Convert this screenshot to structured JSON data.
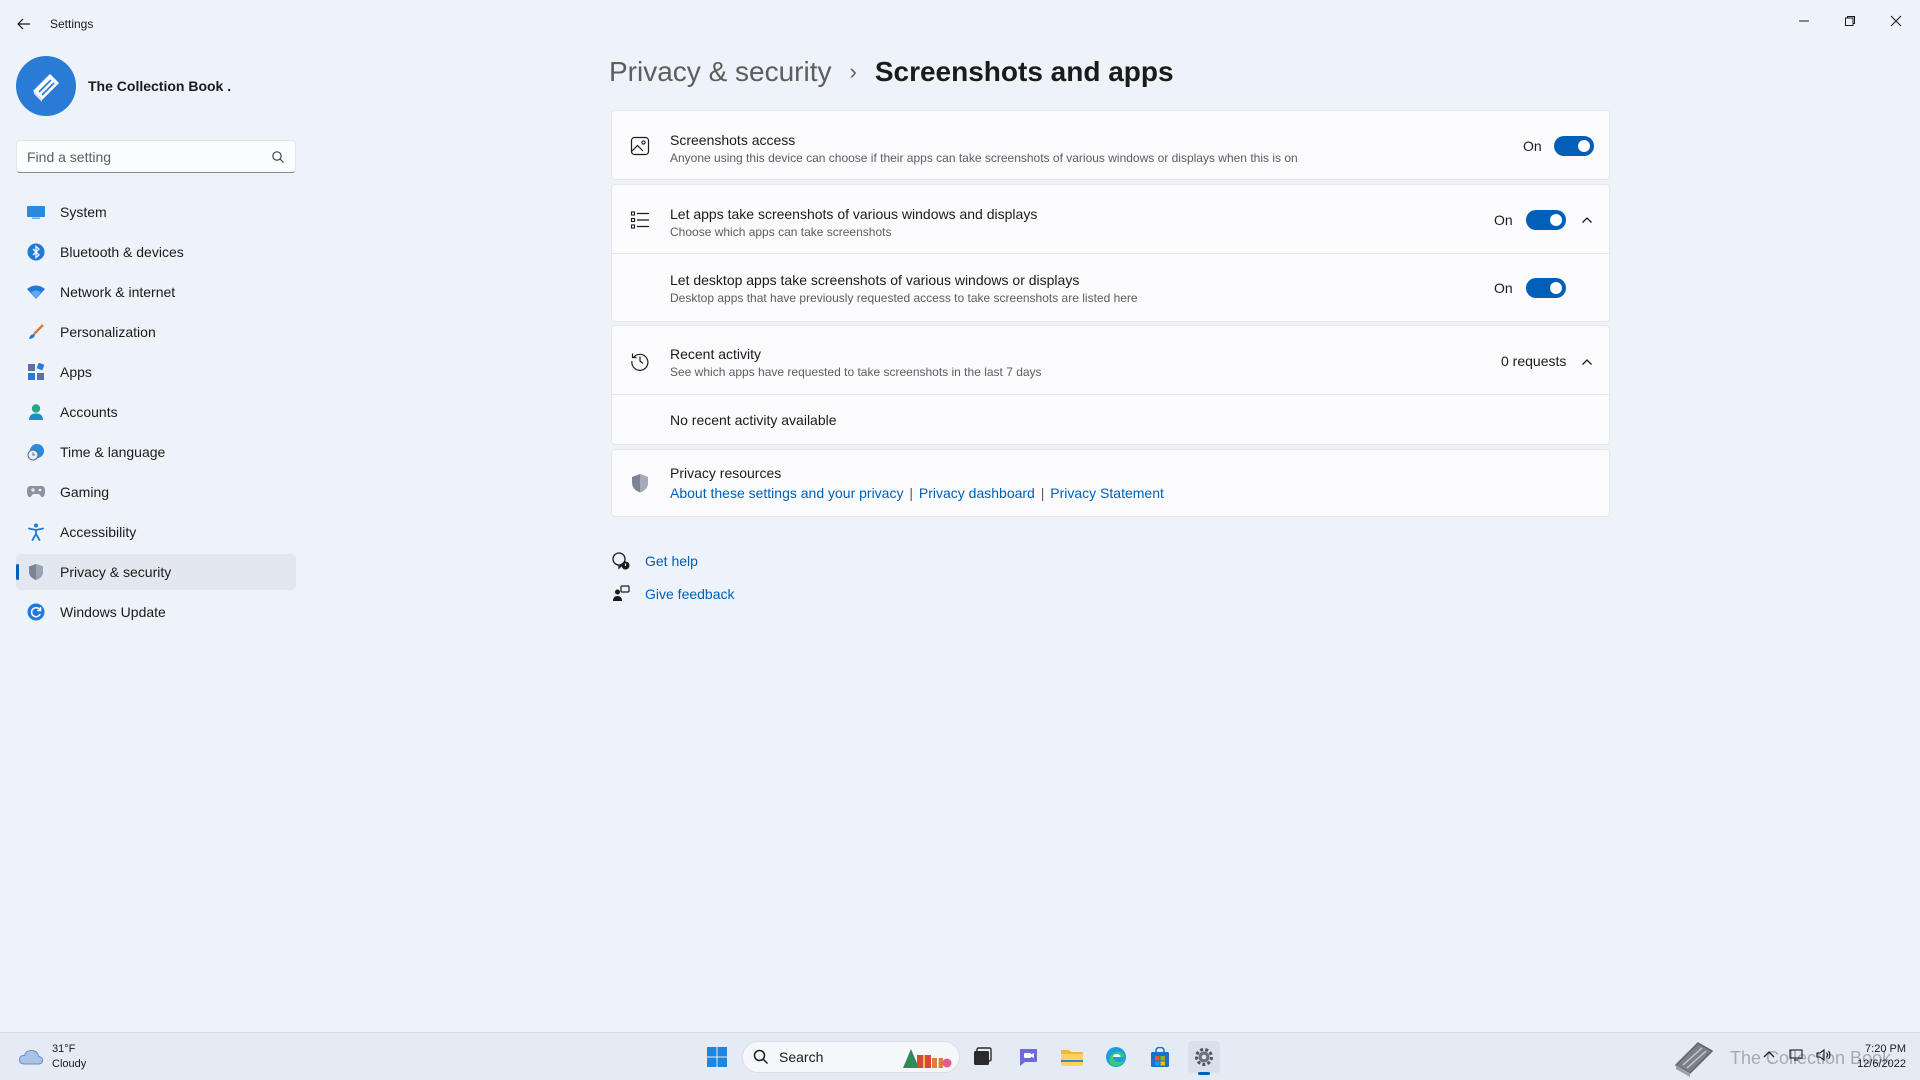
{
  "window": {
    "title": "Settings"
  },
  "profile": {
    "name": "The Collection Book ."
  },
  "search": {
    "placeholder": "Find a setting"
  },
  "nav": {
    "items": [
      {
        "label": "System",
        "icon": "monitor-icon"
      },
      {
        "label": "Bluetooth & devices",
        "icon": "bluetooth-icon"
      },
      {
        "label": "Network & internet",
        "icon": "wifi-icon"
      },
      {
        "label": "Personalization",
        "icon": "brush-icon"
      },
      {
        "label": "Apps",
        "icon": "apps-icon"
      },
      {
        "label": "Accounts",
        "icon": "person-icon"
      },
      {
        "label": "Time & language",
        "icon": "globe-clock-icon"
      },
      {
        "label": "Gaming",
        "icon": "gamepad-icon"
      },
      {
        "label": "Accessibility",
        "icon": "accessibility-icon"
      },
      {
        "label": "Privacy & security",
        "icon": "shield-icon",
        "selected": true
      },
      {
        "label": "Windows Update",
        "icon": "refresh-icon"
      }
    ]
  },
  "breadcrumb": {
    "parent": "Privacy & security",
    "separator": "›",
    "current": "Screenshots and apps"
  },
  "settings": {
    "screenshots_access": {
      "title": "Screenshots access",
      "desc": "Anyone using this device can choose if their apps can take screenshots of various windows or displays when this is on",
      "state": "On"
    },
    "let_apps": {
      "title": "Let apps take screenshots of various windows and displays",
      "desc": "Choose which apps can take screenshots",
      "state": "On"
    },
    "desktop_apps": {
      "title": "Let desktop apps take screenshots of various windows or displays",
      "desc": "Desktop apps that have previously requested access to take screenshots are listed here",
      "state": "On"
    },
    "recent_activity": {
      "title": "Recent activity",
      "desc": "See which apps have requested to take screenshots in the last 7 days",
      "count": "0 requests",
      "empty": "No recent activity available"
    },
    "privacy_resources": {
      "title": "Privacy resources",
      "links": [
        "About these settings and your privacy",
        "Privacy dashboard",
        "Privacy Statement"
      ],
      "separator": "|"
    }
  },
  "help": {
    "get_help": "Get help",
    "give_feedback": "Give feedback"
  },
  "taskbar": {
    "weather": {
      "temp": "31°F",
      "condition": "Cloudy"
    },
    "search_label": "Search",
    "watermark": "The Collection Book",
    "time": "7:20 PM",
    "date": "12/6/2022"
  },
  "colors": {
    "accent": "#005fb8",
    "background": "#eef2f9",
    "card": "#fbfbfd"
  }
}
